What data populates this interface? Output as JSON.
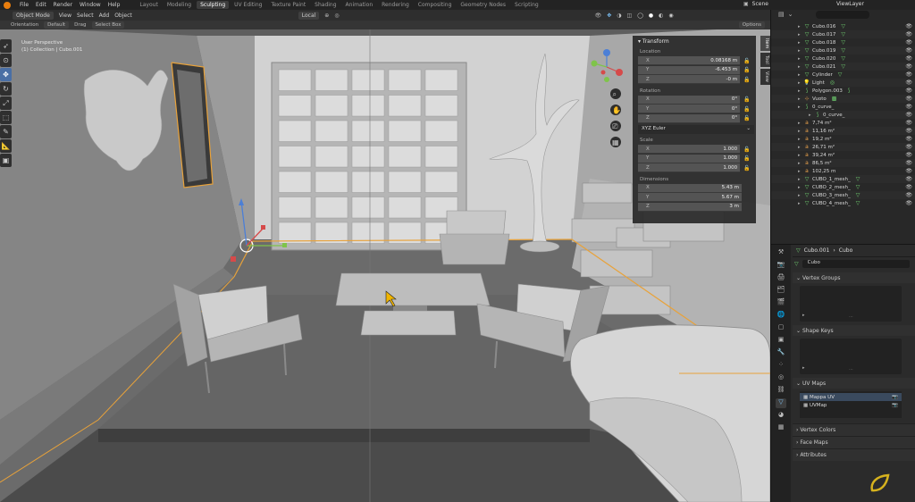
{
  "topbar": {
    "menu": [
      "File",
      "Edit",
      "Render",
      "Window",
      "Help"
    ],
    "workspaces": [
      "Layout",
      "Modeling",
      "Sculpting",
      "UV Editing",
      "Texture Paint",
      "Shading",
      "Animation",
      "Rendering",
      "Compositing",
      "Geometry Nodes",
      "Scripting"
    ],
    "active_workspace": "Sculpting",
    "scene": "Scene",
    "view_layer": "ViewLayer"
  },
  "viewport": {
    "mode": "Object Mode",
    "menus": [
      "View",
      "Select",
      "Add",
      "Object"
    ],
    "transform_space": "Local",
    "orientation_label": "Orientation",
    "orientation_value": "Default",
    "drag_label": "Drag",
    "drag_value": "Select Box",
    "options": "Options",
    "perspective": "User Perspective",
    "collection_path": "(1) Collection | Cubo.001"
  },
  "transform_panel": {
    "title": "Transform",
    "location_label": "Location",
    "location": [
      {
        "axis": "X",
        "value": "0.08168 m"
      },
      {
        "axis": "Y",
        "value": "-6.453 m"
      },
      {
        "axis": "Z",
        "value": "-0 m"
      }
    ],
    "rotation_label": "Rotation",
    "rotation": [
      {
        "axis": "X",
        "value": "0°"
      },
      {
        "axis": "Y",
        "value": "0°"
      },
      {
        "axis": "Z",
        "value": "0°"
      }
    ],
    "rotation_mode": "XYZ Euler",
    "scale_label": "Scale",
    "scale": [
      {
        "axis": "X",
        "value": "1.000"
      },
      {
        "axis": "Y",
        "value": "1.000"
      },
      {
        "axis": "Z",
        "value": "1.000"
      }
    ],
    "dimensions_label": "Dimensions",
    "dimensions": [
      {
        "axis": "X",
        "value": "5.43 m"
      },
      {
        "axis": "Y",
        "value": "5.67 m"
      },
      {
        "axis": "Z",
        "value": "3 m"
      }
    ],
    "tabs": [
      "Item",
      "Tool",
      "View"
    ]
  },
  "outliner": {
    "items": [
      {
        "name": "Cubo.016",
        "icon": "mesh",
        "extra": "mesh-data"
      },
      {
        "name": "Cubo.017",
        "icon": "mesh",
        "extra": "mesh-data"
      },
      {
        "name": "Cubo.018",
        "icon": "mesh",
        "extra": "mesh-data"
      },
      {
        "name": "Cubo.019",
        "icon": "mesh",
        "extra": "mesh-data"
      },
      {
        "name": "Cubo.020",
        "icon": "mesh",
        "extra": "mesh-data"
      },
      {
        "name": "Cubo.021",
        "icon": "mesh",
        "extra": "mesh-data"
      },
      {
        "name": "Cylinder",
        "icon": "mesh",
        "extra": "mesh-data"
      },
      {
        "name": "Light",
        "icon": "light",
        "extra": "light-data"
      },
      {
        "name": "Polygon.003",
        "icon": "curve",
        "extra": "curve-data"
      },
      {
        "name": "Vuoto",
        "icon": "empty",
        "extra": "constraint"
      },
      {
        "name": "0_curve_",
        "icon": "curve",
        "extra": ""
      },
      {
        "name": "0_curve_",
        "icon": "curve",
        "extra": ""
      },
      {
        "name": "7,74 m²",
        "icon": "text",
        "extra": ""
      },
      {
        "name": "11,16 m²",
        "icon": "text",
        "extra": ""
      },
      {
        "name": "19,2 m²",
        "icon": "text",
        "extra": ""
      },
      {
        "name": "26,71 m²",
        "icon": "text",
        "extra": ""
      },
      {
        "name": "39,24 m²",
        "icon": "text",
        "extra": ""
      },
      {
        "name": "86,5 m²",
        "icon": "text",
        "extra": ""
      },
      {
        "name": "102,25 m",
        "icon": "text",
        "extra": ""
      },
      {
        "name": "CUBO_1_mesh_",
        "icon": "mesh",
        "extra": "mesh-data"
      },
      {
        "name": "CUBO_2_mesh_",
        "icon": "mesh",
        "extra": "mesh-data"
      },
      {
        "name": "CUBO_3_mesh_",
        "icon": "mesh",
        "extra": "mesh-data"
      },
      {
        "name": "CUBO_4_mesh_",
        "icon": "mesh",
        "extra": "mesh-data"
      }
    ]
  },
  "properties": {
    "breadcrumb_object": "Cubo.001",
    "breadcrumb_data": "Cubo",
    "data_name": "Cubo",
    "sections": {
      "vertex_groups": "Vertex Groups",
      "shape_keys": "Shape Keys",
      "uv_maps": "UV Maps",
      "vertex_colors": "Vertex Colors",
      "face_maps": "Face Maps",
      "attributes": "Attributes"
    },
    "uv_maps": [
      "Mappa UV",
      "UVMap"
    ]
  },
  "colors": {
    "accent": "#4a6fa5",
    "selection_orange": "#e8a23a",
    "mesh_green": "#6fcf6f"
  }
}
